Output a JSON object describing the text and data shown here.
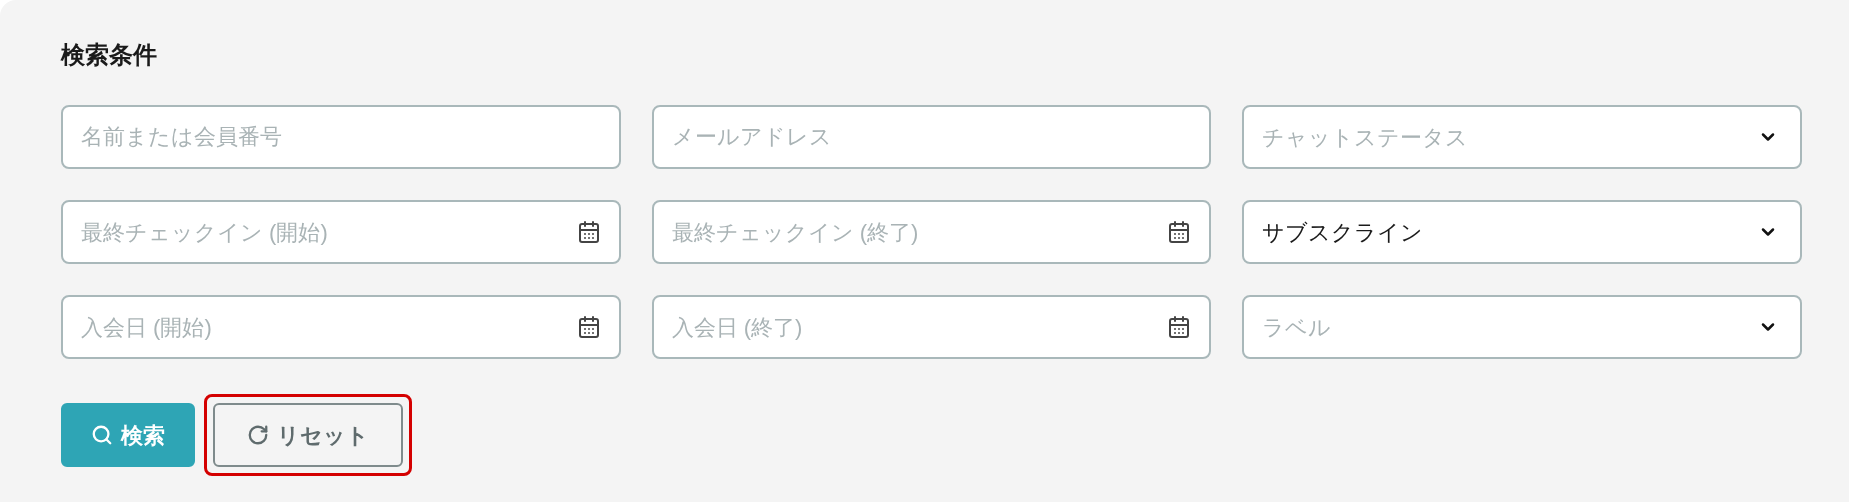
{
  "title": "検索条件",
  "fields": [
    {
      "kind": "text",
      "placeholder": "名前または会員番号"
    },
    {
      "kind": "text",
      "placeholder": "メールアドレス"
    },
    {
      "kind": "select",
      "placeholder": "チャットステータス"
    },
    {
      "kind": "date",
      "placeholder": "最終チェックイン (開始)"
    },
    {
      "kind": "date",
      "placeholder": "最終チェックイン (終了)"
    },
    {
      "kind": "select",
      "value": "サブスクライン"
    },
    {
      "kind": "date",
      "placeholder": "入会日 (開始)"
    },
    {
      "kind": "date",
      "placeholder": "入会日 (終了)"
    },
    {
      "kind": "select",
      "placeholder": "ラベル"
    }
  ],
  "buttons": [
    {
      "kind": "search",
      "label": "検索",
      "focused": false
    },
    {
      "kind": "reset",
      "label": "リセット",
      "focused": true
    }
  ]
}
